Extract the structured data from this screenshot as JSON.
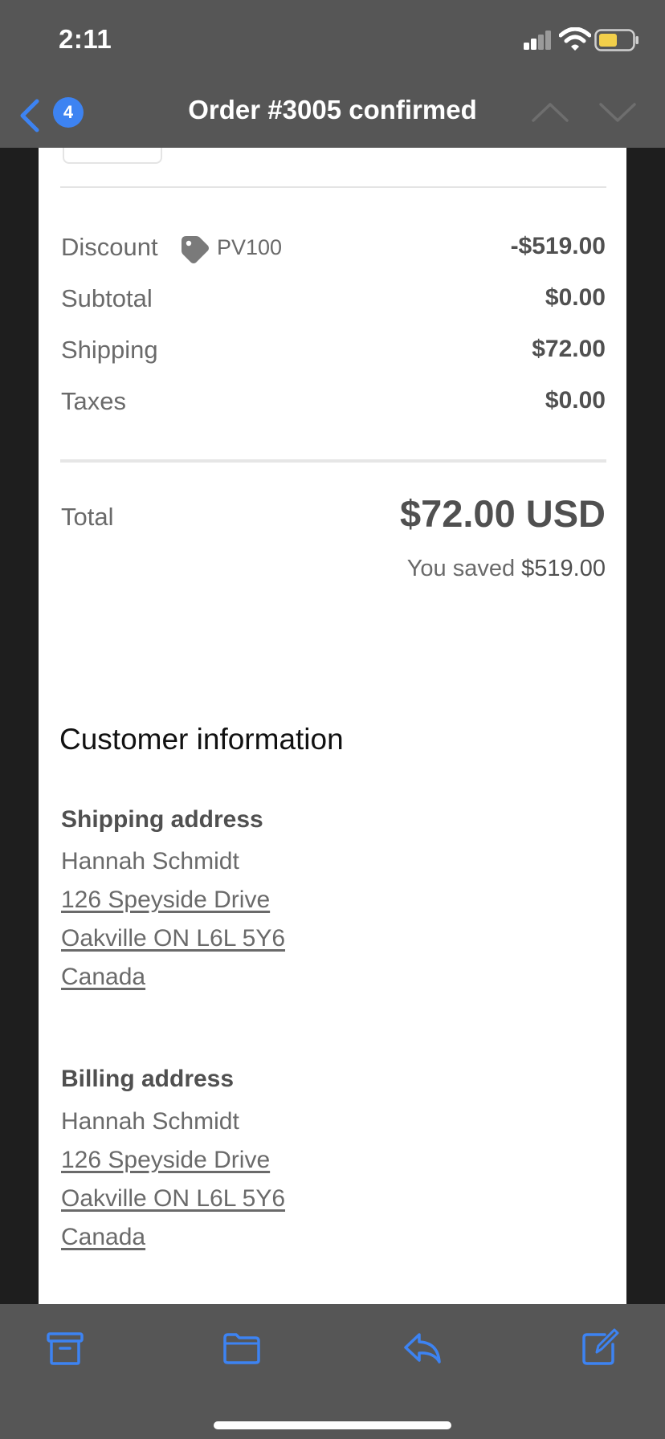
{
  "status_bar": {
    "time": "2:11",
    "icons": [
      "cellular-signal-icon",
      "wifi-icon",
      "battery-icon"
    ],
    "battery_color": "#f2cf4a"
  },
  "nav": {
    "back_icon": "chevron-left-icon",
    "unread_badge": "4",
    "title": "Order #3005 confirmed",
    "prev_icon": "chevron-up-icon",
    "next_icon": "chevron-down-icon",
    "accent": "#3d83f2"
  },
  "summary": {
    "discount": {
      "label": "Discount",
      "code": "PV100",
      "amount": "-$519.00",
      "icon": "tag-icon"
    },
    "subtotal": {
      "label": "Subtotal",
      "amount": "$0.00"
    },
    "shipping": {
      "label": "Shipping",
      "amount": "$72.00"
    },
    "taxes": {
      "label": "Taxes",
      "amount": "$0.00"
    }
  },
  "total": {
    "label": "Total",
    "amount": "$72.00 USD",
    "saved_prefix": "You saved",
    "saved_amount": "$519.00"
  },
  "customer": {
    "title": "Customer information",
    "shipping": {
      "heading": "Shipping address",
      "name": "Hannah Schmidt",
      "street": "126 Speyside Drive",
      "city": "Oakville ON L6L 5Y6",
      "country": "Canada"
    },
    "billing": {
      "heading": "Billing address",
      "name": "Hannah Schmidt",
      "street": "126 Speyside Drive",
      "city": "Oakville ON L6L 5Y6",
      "country": "Canada"
    }
  },
  "toolbar": {
    "icons": [
      "archive-icon",
      "folder-icon",
      "reply-icon",
      "compose-icon"
    ]
  }
}
